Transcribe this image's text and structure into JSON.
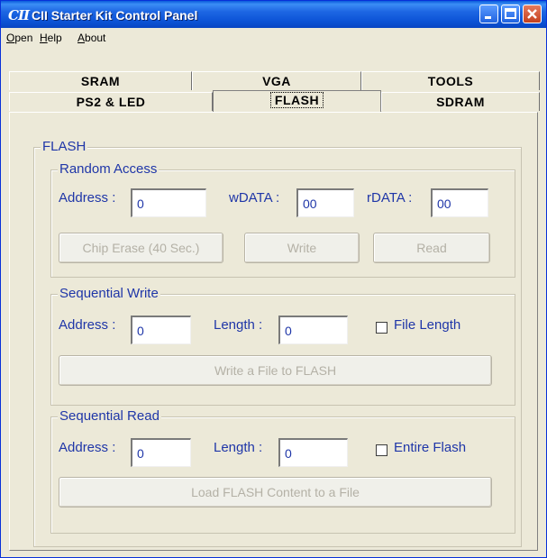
{
  "window": {
    "app_icon_text": "CII",
    "title": "CII Starter Kit Control Panel"
  },
  "menu": [
    "Open",
    "Help",
    "About"
  ],
  "tabs": {
    "row1": [
      "SRAM",
      "VGA",
      "TOOLS"
    ],
    "row2": [
      "PS2 & LED",
      "FLASH",
      "SDRAM"
    ],
    "active": "FLASH"
  },
  "flash": {
    "group_title": "FLASH",
    "random_access": {
      "title": "Random Access",
      "address_label": "Address :",
      "address_value": "0",
      "wdata_label": "wDATA :",
      "wdata_value": "00",
      "rdata_label": "rDATA :",
      "rdata_value": "00",
      "chip_erase_label": "Chip Erase (40 Sec.)",
      "write_label": "Write",
      "read_label": "Read"
    },
    "sequential_write": {
      "title": "Sequential Write",
      "address_label": "Address :",
      "address_value": "0",
      "length_label": "Length :",
      "length_value": "0",
      "file_length_label": "File Length",
      "file_length_checked": false,
      "write_file_label": "Write a File to FLASH"
    },
    "sequential_read": {
      "title": "Sequential Read",
      "address_label": "Address :",
      "address_value": "0",
      "length_label": "Length :",
      "length_value": "0",
      "entire_flash_label": "Entire Flash",
      "entire_flash_checked": false,
      "load_label": "Load FLASH Content to a File"
    }
  }
}
